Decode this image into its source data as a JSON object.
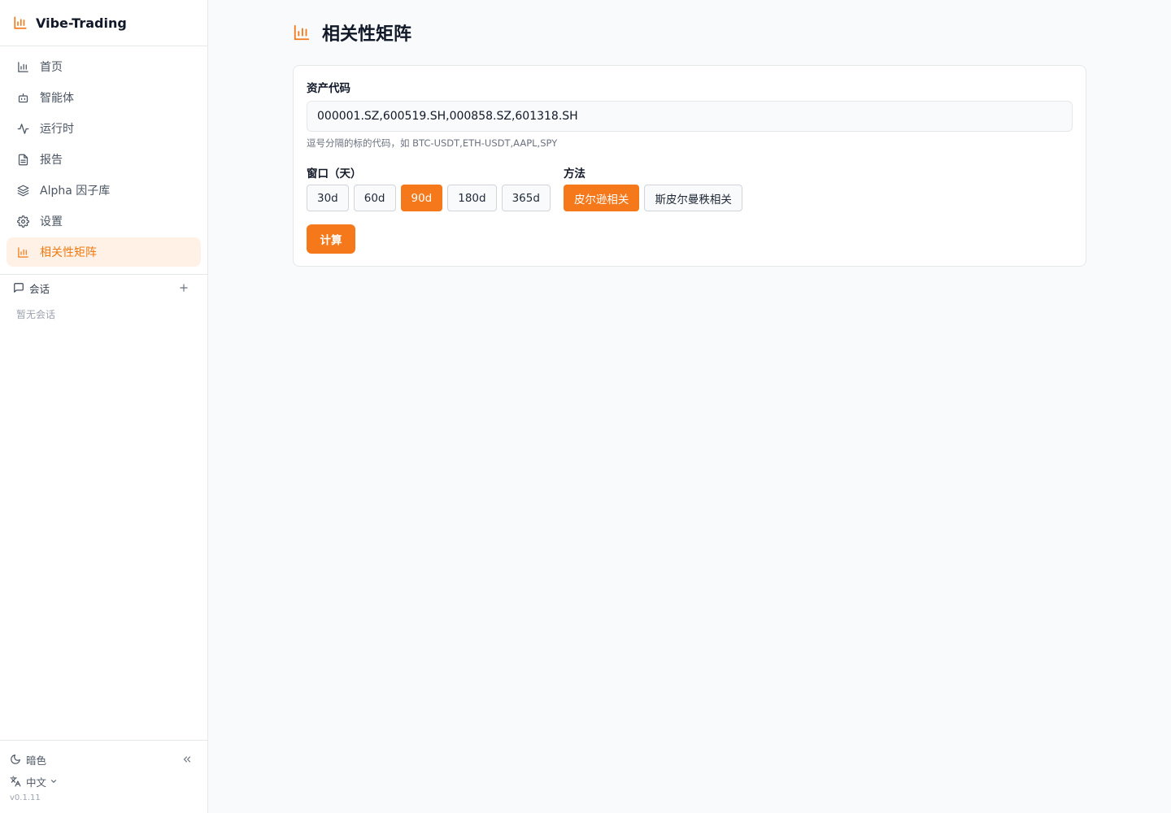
{
  "app": {
    "title": "Vibe-Trading",
    "accent": "#f5781a"
  },
  "sidebar": {
    "items": [
      {
        "label": "首页",
        "icon": "bar-chart-icon"
      },
      {
        "label": "智能体",
        "icon": "bot-icon"
      },
      {
        "label": "运行时",
        "icon": "activity-icon"
      },
      {
        "label": "报告",
        "icon": "file-text-icon"
      },
      {
        "label": "Alpha 因子库",
        "icon": "layers-icon"
      },
      {
        "label": "设置",
        "icon": "gear-icon"
      },
      {
        "label": "相关性矩阵",
        "icon": "bar-chart-icon",
        "active": true
      }
    ],
    "sessions": {
      "title": "会话",
      "empty": "暂无会话"
    },
    "footer": {
      "theme_label": "暗色",
      "language": "中文",
      "version": "v0.1.11"
    }
  },
  "page": {
    "title": "相关性矩阵",
    "assets": {
      "label": "资产代码",
      "value": "000001.SZ,600519.SH,000858.SZ,601318.SH",
      "hint": "逗号分隔的标的代码，如 BTC-USDT,ETH-USDT,AAPL,SPY"
    },
    "window": {
      "label": "窗口（天）",
      "options": [
        "30d",
        "60d",
        "90d",
        "180d",
        "365d"
      ],
      "selected": "90d"
    },
    "method": {
      "label": "方法",
      "options": [
        "皮尔逊相关",
        "斯皮尔曼秩相关"
      ],
      "selected": "皮尔逊相关"
    },
    "compute_label": "计算"
  }
}
